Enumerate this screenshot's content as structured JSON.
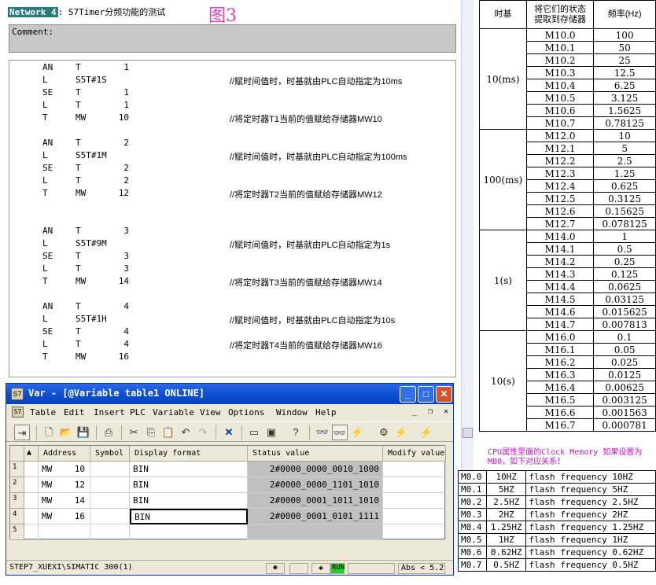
{
  "network": {
    "badge": "Network 4",
    "title": ": S7Timer分频功能的测试",
    "figure_label": "图3",
    "comment_label": "Comment:"
  },
  "code": [
    {
      "op": "AN",
      "a1": "T",
      "a2": "1",
      "comment": ""
    },
    {
      "op": "L",
      "a1": "S5T#1S",
      "a2": "",
      "comment": "//赋时间值时，时基就由PLC自动指定为10ms"
    },
    {
      "op": "SE",
      "a1": "T",
      "a2": "1",
      "comment": ""
    },
    {
      "op": "L",
      "a1": "T",
      "a2": "1",
      "comment": ""
    },
    {
      "op": "T",
      "a1": "MW",
      "a2": "10",
      "comment": "//将定时器T1当前的值赋给存储器MW10"
    },
    {
      "op": "AN",
      "a1": "T",
      "a2": "2",
      "comment": ""
    },
    {
      "op": "L",
      "a1": "S5T#1M",
      "a2": "",
      "comment": "//赋时间值时，时基就由PLC自动指定为100ms"
    },
    {
      "op": "SE",
      "a1": "T",
      "a2": "2",
      "comment": ""
    },
    {
      "op": "L",
      "a1": "T",
      "a2": "2",
      "comment": ""
    },
    {
      "op": "T",
      "a1": "MW",
      "a2": "12",
      "comment": "//将定时器T2当前的值赋给存储器MW12"
    },
    {
      "op": "AN",
      "a1": "T",
      "a2": "3",
      "comment": ""
    },
    {
      "op": "L",
      "a1": "S5T#9M",
      "a2": "",
      "comment": "//赋时间值时，时基就由PLC自动指定为1s"
    },
    {
      "op": "SE",
      "a1": "T",
      "a2": "3",
      "comment": ""
    },
    {
      "op": "L",
      "a1": "T",
      "a2": "3",
      "comment": ""
    },
    {
      "op": "T",
      "a1": "MW",
      "a2": "14",
      "comment": "//将定时器T3当前的值赋给存储器MW14"
    },
    {
      "op": "AN",
      "a1": "T",
      "a2": "4",
      "comment": ""
    },
    {
      "op": "L",
      "a1": "S5T#1H",
      "a2": "",
      "comment": "//赋时间值时，时基就由PLC自动指定为10s"
    },
    {
      "op": "SE",
      "a1": "T",
      "a2": "4",
      "comment": ""
    },
    {
      "op": "L",
      "a1": "T",
      "a2": "4",
      "comment": "//将定时器T4当前的值赋给存储器MW16"
    },
    {
      "op": "T",
      "a1": "MW",
      "a2": "16",
      "comment": ""
    }
  ],
  "right_table": {
    "headers": [
      "时基",
      "将它们的状态\n提取到存储器",
      "频率(Hz)"
    ],
    "groups": [
      {
        "base": "10(ms)",
        "rows": [
          [
            "M10.0",
            "100"
          ],
          [
            "M10.1",
            "50"
          ],
          [
            "M10.2",
            "25"
          ],
          [
            "M10.3",
            "12.5"
          ],
          [
            "M10.4",
            "6.25"
          ],
          [
            "M10.5",
            "3.125"
          ],
          [
            "M10.6",
            "1.5625"
          ],
          [
            "M10.7",
            "0.78125"
          ]
        ]
      },
      {
        "base": "100(ms)",
        "rows": [
          [
            "M12.0",
            "10"
          ],
          [
            "M12.1",
            "5"
          ],
          [
            "M12.2",
            "2.5"
          ],
          [
            "M12.3",
            "1.25"
          ],
          [
            "M12.4",
            "0.625"
          ],
          [
            "M12.5",
            "0.3125"
          ],
          [
            "M12.6",
            "0.15625"
          ],
          [
            "M12.7",
            "0.078125"
          ]
        ]
      },
      {
        "base": "1(s)",
        "rows": [
          [
            "M14.0",
            "1"
          ],
          [
            "M14.1",
            "0.5"
          ],
          [
            "M14.2",
            "0.25"
          ],
          [
            "M14.3",
            "0.125"
          ],
          [
            "M14.4",
            "0.0625"
          ],
          [
            "M14.5",
            "0.03125"
          ],
          [
            "M14.6",
            "0.015625"
          ],
          [
            "M14.7",
            "0.007813"
          ]
        ]
      },
      {
        "base": "10(s)",
        "rows": [
          [
            "M16.0",
            "0.1"
          ],
          [
            "M16.1",
            "0.05"
          ],
          [
            "M16.2",
            "0.025"
          ],
          [
            "M16.3",
            "0.0125"
          ],
          [
            "M16.4",
            "0.00625"
          ],
          [
            "M16.5",
            "0.003125"
          ],
          [
            "M16.6",
            "0.001563"
          ],
          [
            "M16.7",
            "0.000781"
          ]
        ]
      }
    ]
  },
  "cpu_note": "CPU属性里面的Clock Memory 如果设置为MB0，如下对应关系！",
  "clock_table": [
    [
      "M0.0",
      "10HZ",
      "flash frequency 10HZ"
    ],
    [
      "M0.1",
      "5HZ",
      "flash frequency 5HZ"
    ],
    [
      "M0.2",
      "2.5HZ",
      "flash frequency 2.5HZ"
    ],
    [
      "M0.3",
      "2HZ",
      "flash frequency 2HZ"
    ],
    [
      "M0.4",
      "1.25HZ",
      "flash frequency 1.25HZ"
    ],
    [
      "M0.5",
      "1HZ",
      "flash frequency 1HZ"
    ],
    [
      "M0.6",
      "0.62HZ",
      "flash frequency 0.62HZ"
    ],
    [
      "M0.7",
      "0.5HZ",
      "flash frequency 0.5HZ"
    ]
  ],
  "var_window": {
    "title": "Var - [@Variable table1  ONLINE]",
    "title_icon": "S7",
    "menu": [
      "Table",
      "Edit",
      "Insert",
      "PLC",
      "Variable",
      "View",
      "Options",
      "Window",
      "Help"
    ],
    "columns": [
      "Address",
      "Symbol",
      "Display format",
      "Status value",
      "Modify value"
    ],
    "rows": [
      {
        "n": "1",
        "addr": "MW",
        "num": "10",
        "symbol": "",
        "fmt": "BIN",
        "status": "2#0000_0000_0010_1000",
        "modify": ""
      },
      {
        "n": "2",
        "addr": "MW",
        "num": "12",
        "symbol": "",
        "fmt": "BIN",
        "status": "2#0000_0000_1101_1010",
        "modify": ""
      },
      {
        "n": "3",
        "addr": "MW",
        "num": "14",
        "symbol": "",
        "fmt": "BIN",
        "status": "2#0000_0001_1011_1010",
        "modify": ""
      },
      {
        "n": "4",
        "addr": "MW",
        "num": "16",
        "symbol": "",
        "fmt": "BIN",
        "status": "2#0000_0001_0101_1111",
        "modify": ""
      },
      {
        "n": "5",
        "addr": "",
        "num": "",
        "symbol": "",
        "fmt": "",
        "status": "",
        "modify": ""
      }
    ],
    "status_path": "STEP7_XUEXI\\SIMATIC 300(1)",
    "status_run": "RUN",
    "status_abs": "Abs < 5.2"
  }
}
